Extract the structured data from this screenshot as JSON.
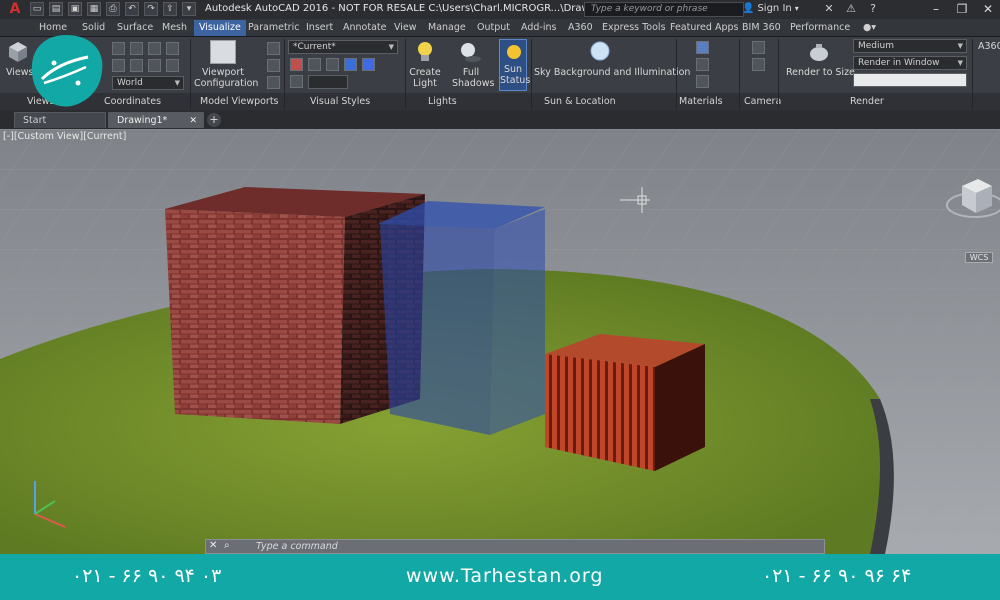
{
  "titlebar": {
    "app_letter": "A",
    "window_title": "Autodesk AutoCAD 2016 - NOT FOR RESALE    C:\\Users\\Charl.MICROGR...\\Drawing1.dwg",
    "search_placeholder": "Type a keyword or phrase",
    "sign_in": "Sign In",
    "help": "?"
  },
  "ribbon_tabs": [
    {
      "label": "Home"
    },
    {
      "label": "Solid"
    },
    {
      "label": "Surface"
    },
    {
      "label": "Mesh"
    },
    {
      "label": "Visualize"
    },
    {
      "label": "Parametric"
    },
    {
      "label": "Insert"
    },
    {
      "label": "Annotate"
    },
    {
      "label": "View"
    },
    {
      "label": "Manage"
    },
    {
      "label": "Output"
    },
    {
      "label": "Add-ins"
    },
    {
      "label": "A360"
    },
    {
      "label": "Express Tools"
    },
    {
      "label": "Featured Apps"
    },
    {
      "label": "BIM 360"
    },
    {
      "label": "Performance"
    }
  ],
  "active_tab": "Visualize",
  "ribbon": {
    "views_label": "Views",
    "coordinates_dd": "World",
    "viewport_config": "Viewport Configuration",
    "visual_style_dd": "*Current*",
    "create_light": "Create Light",
    "full_shadows": "Full Shadows",
    "sun_status": "Sun Status",
    "sky_background": "Sky Background and Illumination",
    "render_to_size": "Render to Size",
    "render_preset_dd": "Medium",
    "render_target_dd": "Render in Window",
    "a360": "A360",
    "panels": {
      "views": "Views",
      "coordinates": "Coordinates",
      "model_viewports": "Model Viewports",
      "visual_styles": "Visual Styles",
      "lights": "Lights",
      "sun_location": "Sun & Location",
      "materials": "Materials",
      "camera": "Camera",
      "render": "Render"
    }
  },
  "doc_tabs": [
    {
      "label": "Start"
    },
    {
      "label": "Drawing1*"
    }
  ],
  "new_tab": "+",
  "viewport": {
    "label": "[-][Custom View][Current]",
    "wcs": "WCS",
    "command_placeholder": "Type a command"
  },
  "footer": {
    "phone_left": "۰۲۱ - ۶۶ ۹۰ ۹۴ ۰۳",
    "website": "www.Tarhestan.org",
    "phone_right": "۰۲۱ - ۶۶ ۹۰ ۹۶ ۶۴"
  },
  "brand": {
    "logo_text": "طرحستان",
    "color": "#12a8a6"
  },
  "colors": {
    "accent_tab": "#3c64a0",
    "grass": "#6d8a2a",
    "brick": "#8a3b34",
    "glass": "#2a4aa8",
    "footer": "#12a8a6"
  }
}
